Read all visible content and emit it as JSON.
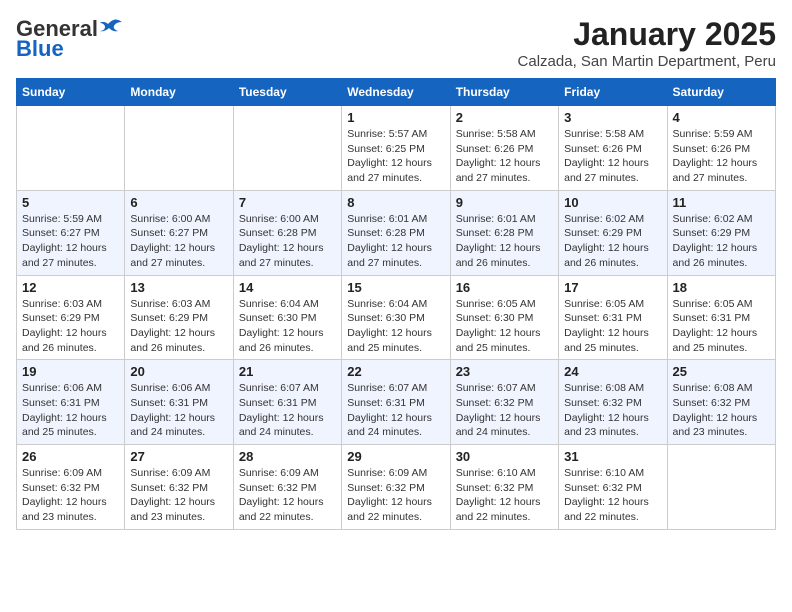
{
  "header": {
    "logo_general": "General",
    "logo_blue": "Blue",
    "title": "January 2025",
    "subtitle": "Calzada, San Martin Department, Peru"
  },
  "weekdays": [
    "Sunday",
    "Monday",
    "Tuesday",
    "Wednesday",
    "Thursday",
    "Friday",
    "Saturday"
  ],
  "weeks": [
    [
      {
        "day": "",
        "info": ""
      },
      {
        "day": "",
        "info": ""
      },
      {
        "day": "",
        "info": ""
      },
      {
        "day": "1",
        "info": "Sunrise: 5:57 AM\nSunset: 6:25 PM\nDaylight: 12 hours and 27 minutes."
      },
      {
        "day": "2",
        "info": "Sunrise: 5:58 AM\nSunset: 6:26 PM\nDaylight: 12 hours and 27 minutes."
      },
      {
        "day": "3",
        "info": "Sunrise: 5:58 AM\nSunset: 6:26 PM\nDaylight: 12 hours and 27 minutes."
      },
      {
        "day": "4",
        "info": "Sunrise: 5:59 AM\nSunset: 6:26 PM\nDaylight: 12 hours and 27 minutes."
      }
    ],
    [
      {
        "day": "5",
        "info": "Sunrise: 5:59 AM\nSunset: 6:27 PM\nDaylight: 12 hours and 27 minutes."
      },
      {
        "day": "6",
        "info": "Sunrise: 6:00 AM\nSunset: 6:27 PM\nDaylight: 12 hours and 27 minutes."
      },
      {
        "day": "7",
        "info": "Sunrise: 6:00 AM\nSunset: 6:28 PM\nDaylight: 12 hours and 27 minutes."
      },
      {
        "day": "8",
        "info": "Sunrise: 6:01 AM\nSunset: 6:28 PM\nDaylight: 12 hours and 27 minutes."
      },
      {
        "day": "9",
        "info": "Sunrise: 6:01 AM\nSunset: 6:28 PM\nDaylight: 12 hours and 26 minutes."
      },
      {
        "day": "10",
        "info": "Sunrise: 6:02 AM\nSunset: 6:29 PM\nDaylight: 12 hours and 26 minutes."
      },
      {
        "day": "11",
        "info": "Sunrise: 6:02 AM\nSunset: 6:29 PM\nDaylight: 12 hours and 26 minutes."
      }
    ],
    [
      {
        "day": "12",
        "info": "Sunrise: 6:03 AM\nSunset: 6:29 PM\nDaylight: 12 hours and 26 minutes."
      },
      {
        "day": "13",
        "info": "Sunrise: 6:03 AM\nSunset: 6:29 PM\nDaylight: 12 hours and 26 minutes."
      },
      {
        "day": "14",
        "info": "Sunrise: 6:04 AM\nSunset: 6:30 PM\nDaylight: 12 hours and 26 minutes."
      },
      {
        "day": "15",
        "info": "Sunrise: 6:04 AM\nSunset: 6:30 PM\nDaylight: 12 hours and 25 minutes."
      },
      {
        "day": "16",
        "info": "Sunrise: 6:05 AM\nSunset: 6:30 PM\nDaylight: 12 hours and 25 minutes."
      },
      {
        "day": "17",
        "info": "Sunrise: 6:05 AM\nSunset: 6:31 PM\nDaylight: 12 hours and 25 minutes."
      },
      {
        "day": "18",
        "info": "Sunrise: 6:05 AM\nSunset: 6:31 PM\nDaylight: 12 hours and 25 minutes."
      }
    ],
    [
      {
        "day": "19",
        "info": "Sunrise: 6:06 AM\nSunset: 6:31 PM\nDaylight: 12 hours and 25 minutes."
      },
      {
        "day": "20",
        "info": "Sunrise: 6:06 AM\nSunset: 6:31 PM\nDaylight: 12 hours and 24 minutes."
      },
      {
        "day": "21",
        "info": "Sunrise: 6:07 AM\nSunset: 6:31 PM\nDaylight: 12 hours and 24 minutes."
      },
      {
        "day": "22",
        "info": "Sunrise: 6:07 AM\nSunset: 6:31 PM\nDaylight: 12 hours and 24 minutes."
      },
      {
        "day": "23",
        "info": "Sunrise: 6:07 AM\nSunset: 6:32 PM\nDaylight: 12 hours and 24 minutes."
      },
      {
        "day": "24",
        "info": "Sunrise: 6:08 AM\nSunset: 6:32 PM\nDaylight: 12 hours and 23 minutes."
      },
      {
        "day": "25",
        "info": "Sunrise: 6:08 AM\nSunset: 6:32 PM\nDaylight: 12 hours and 23 minutes."
      }
    ],
    [
      {
        "day": "26",
        "info": "Sunrise: 6:09 AM\nSunset: 6:32 PM\nDaylight: 12 hours and 23 minutes."
      },
      {
        "day": "27",
        "info": "Sunrise: 6:09 AM\nSunset: 6:32 PM\nDaylight: 12 hours and 23 minutes."
      },
      {
        "day": "28",
        "info": "Sunrise: 6:09 AM\nSunset: 6:32 PM\nDaylight: 12 hours and 22 minutes."
      },
      {
        "day": "29",
        "info": "Sunrise: 6:09 AM\nSunset: 6:32 PM\nDaylight: 12 hours and 22 minutes."
      },
      {
        "day": "30",
        "info": "Sunrise: 6:10 AM\nSunset: 6:32 PM\nDaylight: 12 hours and 22 minutes."
      },
      {
        "day": "31",
        "info": "Sunrise: 6:10 AM\nSunset: 6:32 PM\nDaylight: 12 hours and 22 minutes."
      },
      {
        "day": "",
        "info": ""
      }
    ]
  ]
}
